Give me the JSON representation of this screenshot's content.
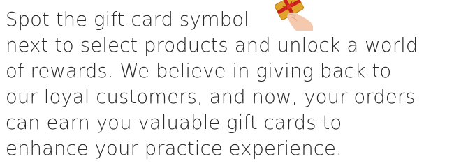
{
  "promo": {
    "lines": [
      "Spot the gift card symbol",
      "next to select products and unlock a world",
      "of rewards. We believe in giving back to",
      "our loyal customers, and now, your orders",
      "can earn you valuable gift cards to",
      "enhance your practice experience."
    ],
    "icon": "gift-card-in-hand-icon"
  },
  "colors": {
    "text": "#2b2b2b",
    "card": "#e0a52a",
    "ribbon": "#c9201f",
    "skin": "#f5c9ae"
  }
}
